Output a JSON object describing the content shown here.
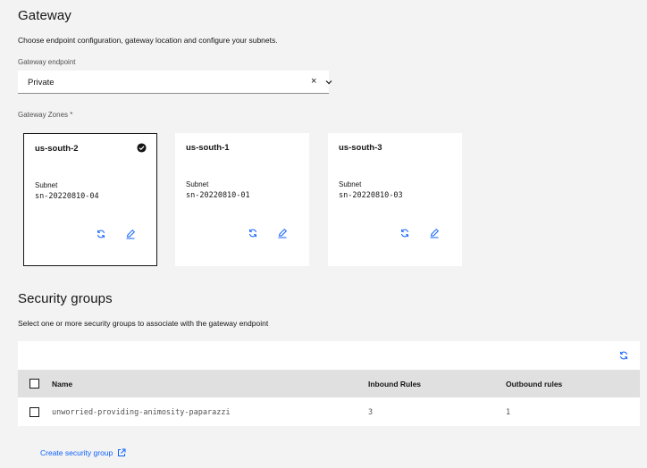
{
  "gateway": {
    "title": "Gateway",
    "description": "Choose endpoint configuration, gateway location and configure your subnets.",
    "endpoint_label": "Gateway endpoint",
    "endpoint_value": "Private",
    "zones_label": "Gateway Zones *"
  },
  "zones": [
    {
      "name": "us-south-2",
      "subnet_label": "Subnet",
      "subnet": "sn-20220810-04",
      "selected": true
    },
    {
      "name": "us-south-1",
      "subnet_label": "Subnet",
      "subnet": "sn-20220810-01",
      "selected": false
    },
    {
      "name": "us-south-3",
      "subnet_label": "Subnet",
      "subnet": "sn-20220810-03",
      "selected": false
    }
  ],
  "security": {
    "title": "Security groups",
    "description": "Select one or more security groups to associate with the gateway endpoint",
    "columns": {
      "name": "Name",
      "inbound": "Inbound Rules",
      "outbound": "Outbound rules"
    },
    "rows": [
      {
        "name": "unworried-providing-animosity-paparazzi",
        "inbound": "3",
        "outbound": "1"
      }
    ],
    "create_link": "Create security group"
  },
  "colors": {
    "accent": "#0f62fe",
    "background": "#f3f3f3",
    "header": "#e0e0e0"
  },
  "icons": [
    "close-icon",
    "chevron-down-icon",
    "checkmark-filled-icon",
    "refresh-icon",
    "edit-icon",
    "launch-icon"
  ]
}
